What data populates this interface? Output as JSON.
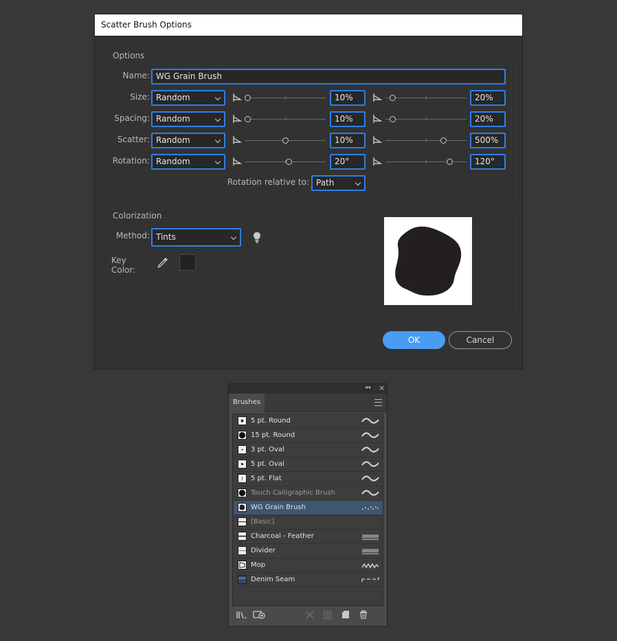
{
  "dialog": {
    "title": "Scatter Brush Options",
    "options_group": "Options",
    "name_label": "Name:",
    "name_value": "WG Grain Brush",
    "rows": [
      {
        "label": "Size:",
        "mode": "Random",
        "min": "10%",
        "max": "20%"
      },
      {
        "label": "Spacing:",
        "mode": "Random",
        "min": "10%",
        "max": "20%"
      },
      {
        "label": "Scatter:",
        "mode": "Random",
        "min": "10%",
        "max": "500%"
      },
      {
        "label": "Rotation:",
        "mode": "Random",
        "min": "20°",
        "max": "120°"
      }
    ],
    "rotation_relative_label": "Rotation relative to:",
    "rotation_relative_value": "Path",
    "colorization_group": "Colorization",
    "method_label": "Method:",
    "method_value": "Tints",
    "key_color_label": "Key Color:",
    "key_color": "#222222",
    "ok_label": "OK",
    "cancel_label": "Cancel"
  },
  "panel": {
    "tab_label": "Brushes",
    "brushes": [
      {
        "name": "5 pt. Round",
        "stroke": "wave"
      },
      {
        "name": "15 pt. Round",
        "stroke": "wave"
      },
      {
        "name": "3 pt. Oval",
        "stroke": "wave"
      },
      {
        "name": "5 pt. Oval",
        "stroke": "wave"
      },
      {
        "name": "5 pt. Flat",
        "stroke": "wave"
      },
      {
        "name": "Touch Calligraphic Brush",
        "stroke": "wave",
        "dim": true
      },
      {
        "name": "WG Grain Brush",
        "stroke": "dots",
        "selected": true
      },
      {
        "name": "[Basic]",
        "stroke": "none",
        "dim": true
      },
      {
        "name": "Charcoal - Feather",
        "stroke": "lines"
      },
      {
        "name": "Divider",
        "stroke": "lines"
      },
      {
        "name": "Mop",
        "stroke": "squiggle"
      },
      {
        "name": "Denim Seam",
        "stroke": "dashes"
      }
    ]
  },
  "colors": {
    "accent": "#2d7fe6",
    "ok_button": "#4a9cf2",
    "selection": "#3f5670"
  }
}
